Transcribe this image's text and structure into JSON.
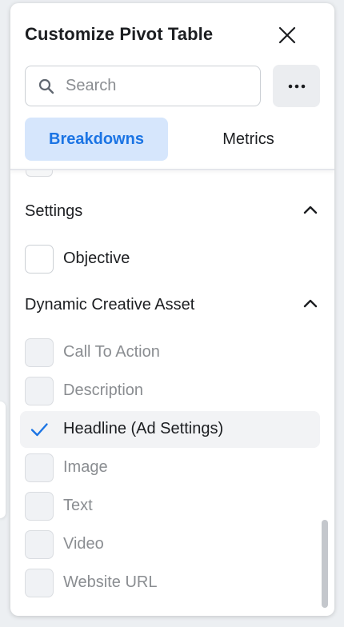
{
  "dialog": {
    "title": "Customize Pivot Table"
  },
  "search": {
    "placeholder": "Search",
    "value": ""
  },
  "tabs": [
    {
      "label": "Breakdowns",
      "active": true
    },
    {
      "label": "Metrics",
      "active": false
    }
  ],
  "sections": [
    {
      "title": "Settings",
      "expanded": true,
      "items": [
        {
          "label": "Objective",
          "checked": false,
          "enabled": true
        }
      ]
    },
    {
      "title": "Dynamic Creative Asset",
      "expanded": true,
      "items": [
        {
          "label": "Call To Action",
          "checked": false,
          "enabled": false
        },
        {
          "label": "Description",
          "checked": false,
          "enabled": false
        },
        {
          "label": "Headline (Ad Settings)",
          "checked": true,
          "enabled": true
        },
        {
          "label": "Image",
          "checked": false,
          "enabled": false
        },
        {
          "label": "Text",
          "checked": false,
          "enabled": false
        },
        {
          "label": "Video",
          "checked": false,
          "enabled": false
        },
        {
          "label": "Website URL",
          "checked": false,
          "enabled": false
        }
      ]
    }
  ],
  "icons": {
    "close": "close-icon",
    "search": "search-icon",
    "more": "more-icon",
    "chevron": "chevron-up-icon",
    "check": "checkmark-icon"
  },
  "colors": {
    "accent": "#1b74e4",
    "tab_active_bg": "#d6e6fc",
    "disabled_text": "#8a8d91"
  }
}
